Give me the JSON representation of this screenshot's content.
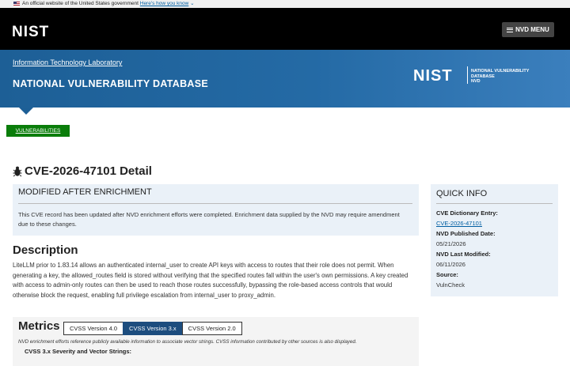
{
  "gov_banner": {
    "text": "An official website of the United States government",
    "link": "Here's how you know"
  },
  "header": {
    "logo": "NIST",
    "menu_label": "NVD MENU"
  },
  "banner": {
    "itl_link": "Information Technology Laboratory",
    "title": "NATIONAL VULNERABILITY DATABASE",
    "logo": "NIST",
    "logo_sub_1": "NATIONAL VULNERABILITY",
    "logo_sub_2": "DATABASE",
    "logo_sub_3": "NVD"
  },
  "breadcrumb": {
    "label": "VULNERABILITIES"
  },
  "page": {
    "title": "CVE-2026-47101 Detail"
  },
  "modified": {
    "heading": "MODIFIED AFTER ENRICHMENT",
    "text": "This CVE record has been updated after NVD enrichment efforts were completed. Enrichment data supplied by the NVD may require amendment due to these changes."
  },
  "description": {
    "heading": "Description",
    "text": "LiteLLM prior to 1.83.14 allows an authenticated internal_user to create API keys with access to routes that their role does not permit. When generating a key, the allowed_routes field is stored without verifying that the specified routes fall within the user's own permissions. A key created with access to admin-only routes can then be used to reach those routes successfully, bypassing the role-based access controls that would otherwise block the request, enabling full privilege escalation from internal_user to proxy_admin."
  },
  "metrics": {
    "heading": "Metrics",
    "tabs": [
      "CVSS Version 4.0",
      "CVSS Version 3.x",
      "CVSS Version 2.0"
    ],
    "active_tab": "CVSS Version 3.x",
    "note": "NVD enrichment efforts reference publicly available information to associate vector strings. CVSS information contributed by other sources is also displayed.",
    "severity_heading": "CVSS 3.x Severity and Vector Strings:"
  },
  "quick_info": {
    "heading": "QUICK INFO",
    "dictionary_label": "CVE Dictionary Entry:",
    "dictionary_value": "CVE-2026-47101",
    "published_label": "NVD Published Date:",
    "published_value": "05/21/2026",
    "modified_label": "NVD Last Modified:",
    "modified_value": "06/11/2026",
    "source_label": "Source:",
    "source_value": "VulnCheck"
  },
  "colors": {
    "header_bg": "#000000",
    "banner_blue": "#246aa5",
    "breadcrumb_green": "#0a7d0a",
    "info_panel": "#eaf1f8",
    "active_tab": "#1d4d7e",
    "link": "#005ea2"
  }
}
